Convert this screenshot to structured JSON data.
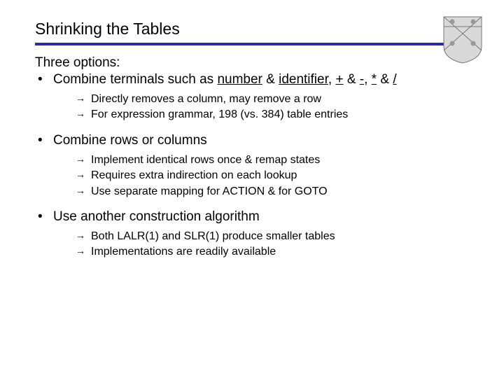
{
  "title": "Shrinking the Tables",
  "intro": "Three options:",
  "items": [
    {
      "text_html": "Combine terminals such as <span class=\"u\">number</span> & <span class=\"u\">identifier</span>, <span class=\"u\">+</span> & <span class=\"u\">-</span>, <span class=\"u\">*</span> & <span class=\"u\">/</span>",
      "subs": [
        "Directly removes a column, may remove a row",
        "For expression grammar, 198 (vs. 384) table entries"
      ]
    },
    {
      "text_html": "Combine rows or columns",
      "subs": [
        "Implement identical rows once & remap states",
        "Requires extra indirection on each lookup",
        "Use separate mapping for A<span class=\"sc\">CTION</span> & for G<span class=\"sc\">OTO</span>"
      ]
    },
    {
      "text_html": "Use another construction algorithm",
      "subs": [
        "Both L<span class=\"sc\">ALR</span>(1) and S<span class=\"sc\">LR</span>(1) produce smaller tables",
        "Implementations are readily available"
      ]
    }
  ]
}
